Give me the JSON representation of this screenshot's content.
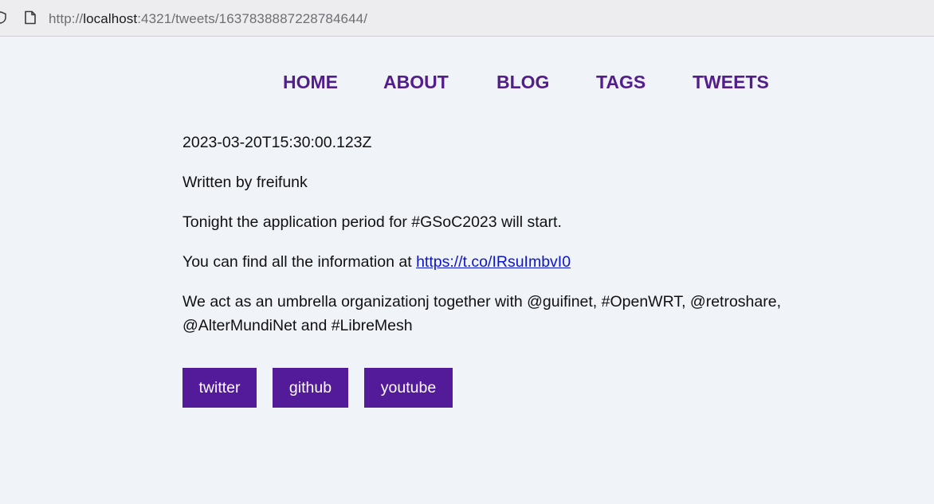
{
  "browser": {
    "url_prefix": "http://",
    "url_host": "localhost",
    "url_rest": ":4321/tweets/1637838887228784644/"
  },
  "nav": {
    "items": [
      "HOME",
      "ABOUT",
      "BLOG",
      "TAGS",
      "TWEETS"
    ]
  },
  "tweet": {
    "timestamp": "2023-03-20T15:30:00.123Z",
    "author_line": "Written by freifunk",
    "line1": "Tonight the application period for #GSoC2023 will start.",
    "line2_text": "You can find all the information at ",
    "line2_link": "https://t.co/IRsuImbvI0",
    "line3_a": "We act as an umbrella organizationj together with @guifinet, #OpenWRT, @retroshare,",
    "line3_b": "@AlterMundiNet and #LibreMesh"
  },
  "buttons": {
    "twitter": "twitter",
    "github": "github",
    "youtube": "youtube"
  },
  "colors": {
    "nav": "#531d8b",
    "button_bg": "#531a99",
    "link": "#0b15cc",
    "page_bg": "#f0f3f8"
  },
  "icons": {
    "shield": "shield-icon",
    "page": "page-icon"
  }
}
